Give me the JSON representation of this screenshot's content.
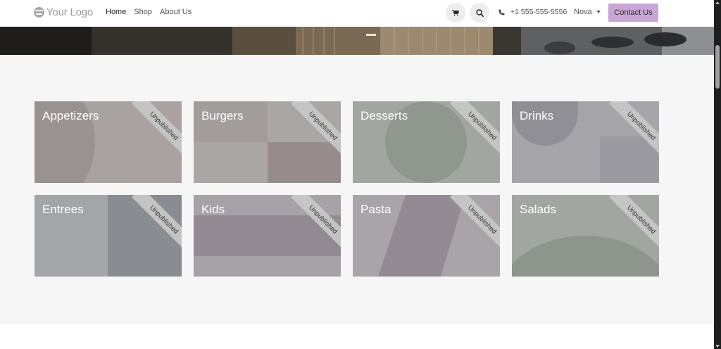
{
  "header": {
    "logo_text": "Your Logo",
    "nav": [
      {
        "label": "Home",
        "active": true
      },
      {
        "label": "Shop",
        "active": false
      },
      {
        "label": "About Us",
        "active": false
      }
    ],
    "phone": "+1 555-555-5556",
    "language": "Nova",
    "contact_label": "Contact Us",
    "accent_color": "#c9a6d6"
  },
  "icons": {
    "cart": "cart-icon",
    "search": "search-icon",
    "phone": "phone-icon",
    "dropdown": "chevron-down-icon"
  },
  "categories": [
    {
      "name": "Appetizers",
      "badge": "Unpublished"
    },
    {
      "name": "Burgers",
      "badge": "Unpublished"
    },
    {
      "name": "Desserts",
      "badge": "Unpublished"
    },
    {
      "name": "Drinks",
      "badge": "Unpublished"
    },
    {
      "name": "Entrees",
      "badge": "Unpublished"
    },
    {
      "name": "Kids",
      "badge": "Unpublished"
    },
    {
      "name": "Pasta",
      "badge": "Unpublished"
    },
    {
      "name": "Salads",
      "badge": "Unpublished"
    }
  ]
}
